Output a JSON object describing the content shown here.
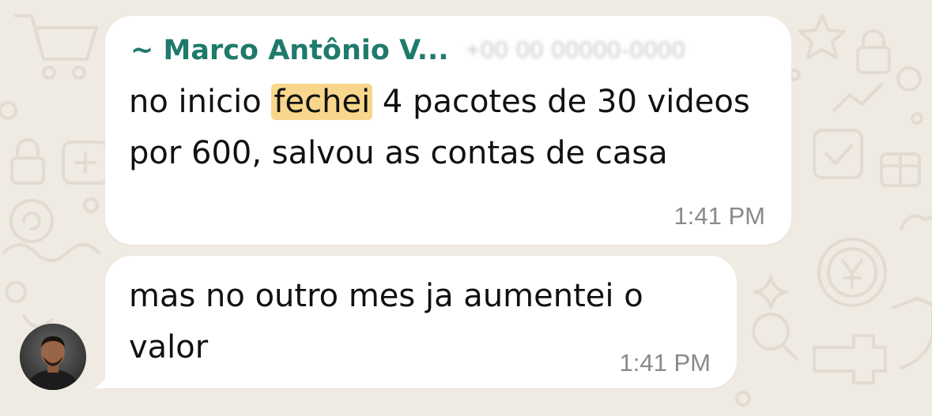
{
  "chat": {
    "message1": {
      "sender_name": "~ Marco Antônio V...",
      "text_before": "no inicio ",
      "highlight": "fechei",
      "text_after": " 4 pacotes de 30 videos por 600, salvou as contas de casa",
      "time": "1:41 PM"
    },
    "message2": {
      "text": "mas no outro mes ja aumentei o valor",
      "time": "1:41 PM"
    }
  },
  "colors": {
    "background": "#efeae2",
    "bubble": "#ffffff",
    "sender_name": "#1f7a6c",
    "highlight": "#f8d68b",
    "timestamp": "#8a8a8a"
  },
  "icons": [
    "wallpaper-doodle-icons",
    "avatar"
  ]
}
